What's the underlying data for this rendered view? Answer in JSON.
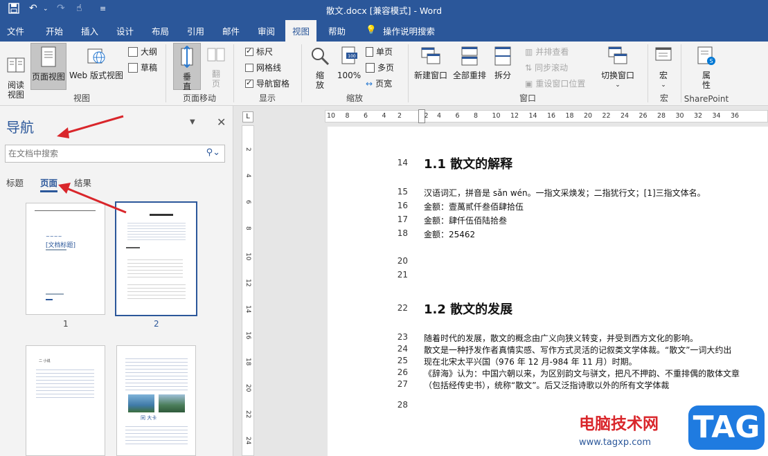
{
  "window": {
    "title": "散文.docx [兼容模式] - Word"
  },
  "tabs": [
    "文件",
    "开始",
    "插入",
    "设计",
    "布局",
    "引用",
    "邮件",
    "审阅",
    "视图",
    "帮助",
    "操作说明搜索"
  ],
  "active_tab": "视图",
  "ribbon": {
    "view": {
      "read_mode": "阅读\n视图",
      "print_layout": "页面视图",
      "web_layout": "Web 版式视图",
      "outline": "大纲",
      "draft": "草稿",
      "label": "视图"
    },
    "page_move": {
      "vertical": "垂直",
      "side_to_side": "翻页",
      "label": "页面移动"
    },
    "show": {
      "ruler": "标尺",
      "gridlines": "网格线",
      "nav_pane": "导航窗格",
      "label": "显示"
    },
    "zoom": {
      "zoom": "缩放",
      "hundred": "100%",
      "one_page": "单页",
      "multi_page": "多页",
      "page_width": "页宽",
      "label": "缩放"
    },
    "window": {
      "new_window": "新建窗口",
      "arrange_all": "全部重排",
      "split": "拆分",
      "side_by_side": "并排查看",
      "sync_scroll": "同步滚动",
      "reset_pos": "重设窗口位置",
      "switch": "切换窗口",
      "label": "窗口"
    },
    "macros": {
      "macro": "宏",
      "label": "宏"
    },
    "sharepoint": {
      "props": "属性",
      "label": "SharePoint"
    }
  },
  "nav": {
    "title": "导航",
    "search_placeholder": "在文档中搜索",
    "tabs": [
      "标题",
      "页面",
      "结果"
    ],
    "active_tab": "页面",
    "thumbs": [
      {
        "num": "1",
        "heading": "[文档标题]"
      },
      {
        "num": "2"
      },
      {
        "num": "",
        "heading": "二 小说"
      },
      {
        "num": "",
        "caption": "同 大卡"
      }
    ]
  },
  "ruler": {
    "h": [
      "10",
      "8",
      "6",
      "4",
      "2",
      "2",
      "4",
      "6",
      "8",
      "10",
      "12",
      "14",
      "16",
      "18",
      "20",
      "22",
      "24",
      "26",
      "28",
      "30",
      "32",
      "34",
      "36"
    ],
    "v": [
      "2",
      "4",
      "6",
      "8",
      "10",
      "12",
      "14",
      "16",
      "18",
      "20",
      "22",
      "24"
    ]
  },
  "doc": {
    "lines": [
      {
        "n": "14",
        "text": "1.1 散文的解释",
        "type": "heading"
      },
      {
        "n": "15",
        "text": "汉语词汇，拼音是 sǎn wén。一指文采焕发；二指犹行文；[1]三指文体名。"
      },
      {
        "n": "16",
        "text": "金额：壹萬贰仟叁佰肆拾伍"
      },
      {
        "n": "17",
        "text": "金额：肆仟伍佰陆拾叁"
      },
      {
        "n": "18",
        "text": "金额：25462"
      },
      {
        "n": "20",
        "text": ""
      },
      {
        "n": "21",
        "text": ""
      },
      {
        "n": "22",
        "text": "1.2 散文的发展",
        "type": "heading"
      },
      {
        "n": "23",
        "text": "随着时代的发展，散文的概念由广义向狭义转变，并受到西方文化的影响。"
      },
      {
        "n": "24",
        "text": "散文是一种抒发作者真情实感、写作方式灵活的记叙类文学体裁。“散文”一词大约出"
      },
      {
        "n": "25",
        "text": "现在北宋太平兴国（976 年 12 月-984 年 11 月）时期。"
      },
      {
        "n": "26",
        "text": "《辞海》认为：中国六朝以来，为区别韵文与骈文，把凡不押韵、不重排偶的散体文章"
      },
      {
        "n": "27",
        "text": "（包括经传史书），统称“散文”。后又泛指诗歌以外的所有文学体裁"
      },
      {
        "n": "28",
        "text": ""
      }
    ]
  },
  "watermark": {
    "site": "电脑技术网",
    "url": "www.tagxp.com",
    "badge": "TAG"
  },
  "colors": {
    "brand": "#2b579a",
    "arrow": "#d9262b"
  }
}
